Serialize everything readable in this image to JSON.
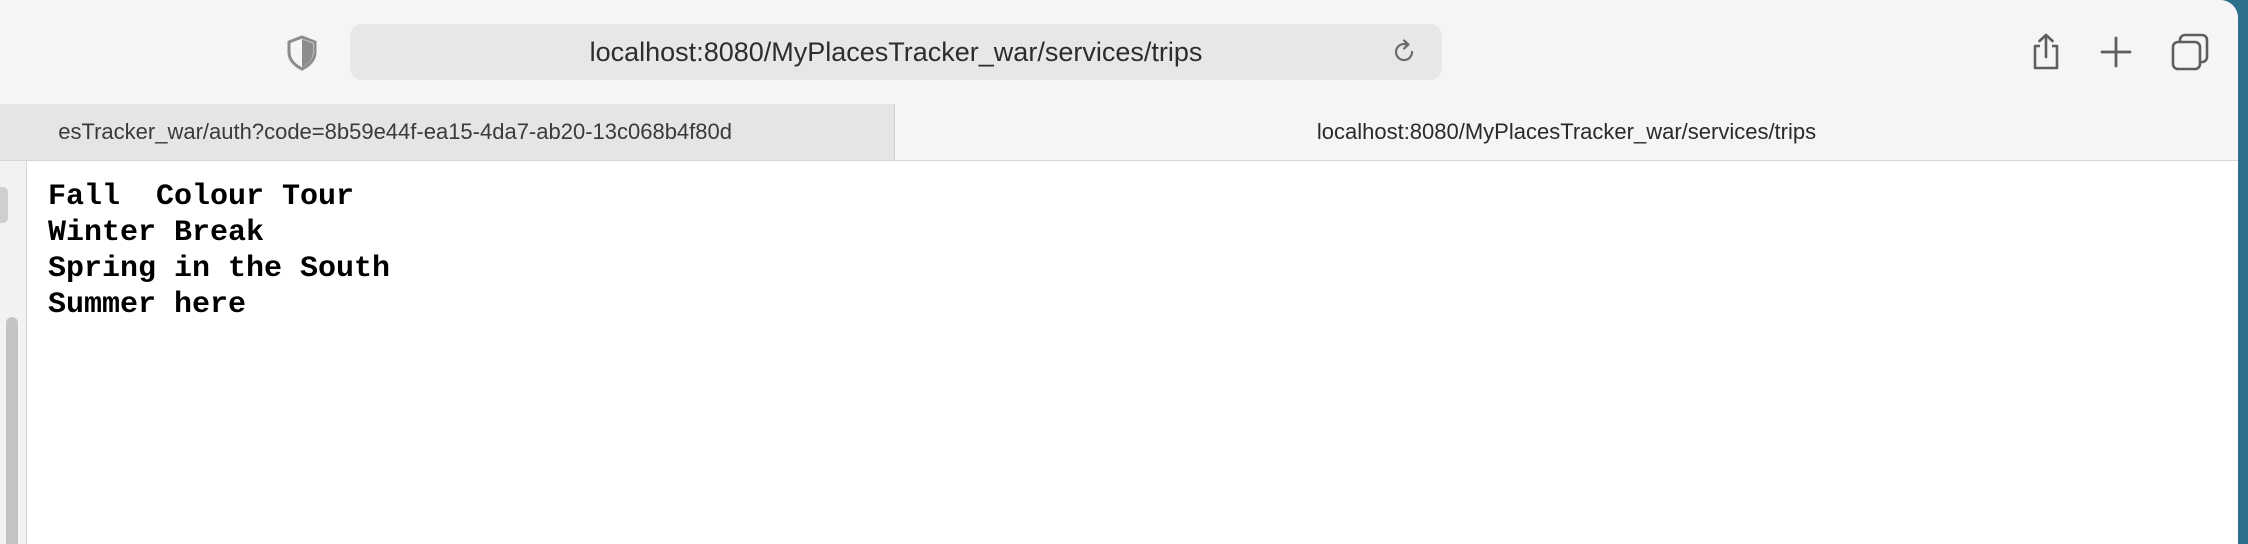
{
  "toolbar": {
    "address": "localhost:8080/MyPlacesTracker_war/services/trips",
    "icons": {
      "privacy": "shield-icon",
      "reload": "reload-icon",
      "share": "share-icon",
      "new_tab": "plus-icon",
      "tab_overview": "tab-overview-icon"
    }
  },
  "tabs": [
    {
      "label": "esTracker_war/auth?code=8b59e44f-ea15-4da7-ab20-13c068b4f80d",
      "active": false
    },
    {
      "label": "localhost:8080/MyPlacesTracker_war/services/trips",
      "active": true
    }
  ],
  "content": {
    "lines": [
      "Fall  Colour Tour",
      "Winter Break",
      "Spring in the South",
      "Summer here"
    ]
  },
  "colors": {
    "toolbar_bg": "#f6f4f5",
    "address_bg": "#e8e6e8",
    "inactive_tab_bg": "#e6e4e6",
    "desktop_bg": "#2b6f8a"
  }
}
